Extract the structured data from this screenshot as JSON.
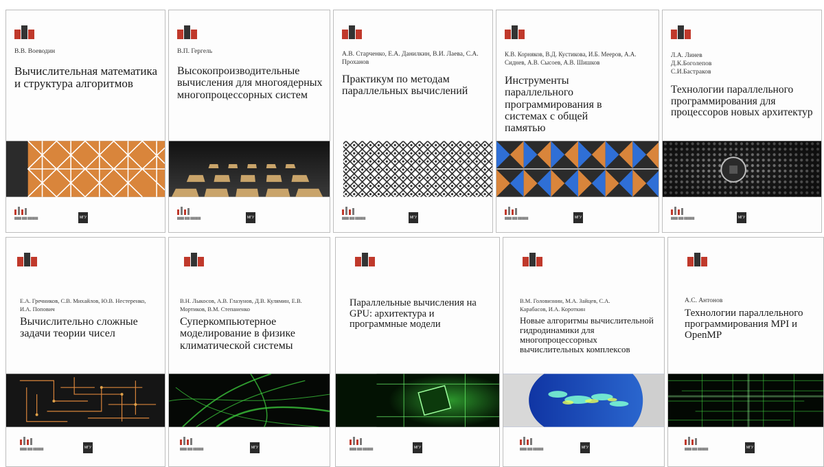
{
  "books": [
    {
      "authors": "В.В. Воеводин",
      "title": "Вычислительная математика и структура алгоритмов",
      "pattern": "lattice-orange"
    },
    {
      "authors": "В.П. Гергель",
      "title": "Высокопроизводительные вычисления для многоядерных многопроцессорных систем",
      "pattern": "chips-gold"
    },
    {
      "authors": "А.В. Старченко, Е.А. Данилкин, В.И. Лаева, С.А. Проханов",
      "title": "Практикум по методам параллельных вычислений",
      "pattern": "lattice-bw"
    },
    {
      "authors": "К.В. Корняков, В.Д. Кустикова, И.Б. Мееров, А.А. Сиднев, А.В. Сысоев, А.В. Шишков",
      "title": "Инструменты параллельного программирования в системах с общей памятью",
      "pattern": "triangles"
    },
    {
      "authors": "Л.А. Линев\nД.К.Боголепов\nС.И.Бастраков",
      "title": "Технологии параллельного программирования для процессоров новых архитектур",
      "pattern": "metal-dots"
    },
    {
      "authors": "Е.А. Гречников, С.В. Михайлов, Ю.В. Нестеренко, И.А. Попович",
      "title": "Вычислительно сложные задачи теории чисел",
      "pattern": "circuit-orange"
    },
    {
      "authors": "В.Н. Лыкосов, А.В. Глазунов, Д.В. Кулямин, Е.В. Мортиков, В.М. Степаненко",
      "title": "Суперкомпьютерное моделирование в физике климатической системы",
      "pattern": "green-waves"
    },
    {
      "authors": "",
      "title": "Параллельные вычисления на GPU: архитектура и программные модели",
      "pattern": "green-chip"
    },
    {
      "authors": "В.М. Головизнин, М.А. Зайцев, С.А. Карабасов, И.А. Короткин",
      "title": "Новые алгоритмы вычислительной гидродинамики для многопроцессорных вычислительных комплексов",
      "pattern": "blue-flow"
    },
    {
      "authors": "А.С. Антонов",
      "title": "Технологии параллельного программирования MPI и OpenMP",
      "pattern": "green-lines"
    }
  ],
  "publisher_mark": "МГУ",
  "colors": {
    "orange": "#d9853b",
    "red": "#c0392b",
    "blue": "#2f6fd6",
    "green": "#3ecf3e",
    "gold": "#c9a46a",
    "dark": "#1b1b1b"
  }
}
